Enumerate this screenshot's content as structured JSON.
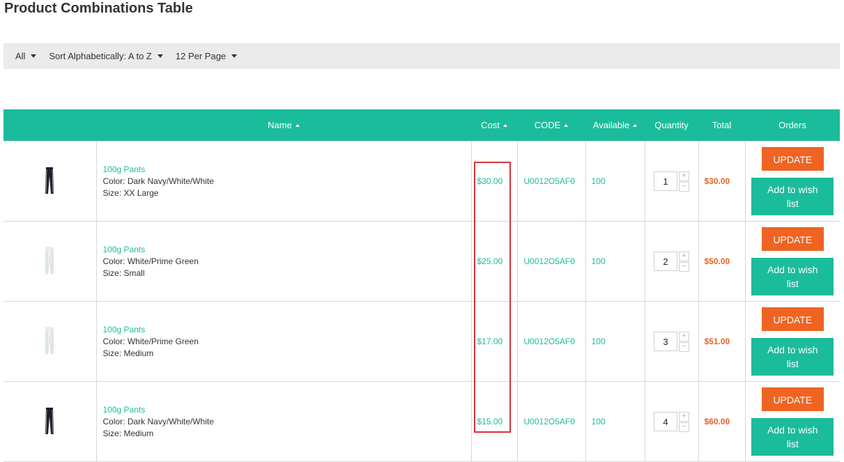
{
  "page": {
    "title": "Product Combinations Table"
  },
  "toolbar": {
    "filter": "All",
    "sort": "Sort Alphabetically: A to Z",
    "per_page": "12 Per Page"
  },
  "table": {
    "headers": {
      "name": "Name",
      "cost": "Cost",
      "code": "CODE",
      "available": "Available",
      "quantity": "Quantity",
      "total": "Total",
      "orders": "Orders"
    },
    "rows": [
      {
        "product": "100g Pants",
        "color": "Color: Dark Navy/White/White",
        "size": "Size: XX Large",
        "cost": "$30.00",
        "code": "U0012O5AF0",
        "available": "100",
        "quantity": "1",
        "total": "$30.00",
        "image": "pants-dark-icon"
      },
      {
        "product": "100g Pants",
        "color": "Color: White/Prime Green",
        "size": "Size: Small",
        "cost": "$25.00",
        "code": "U0012O5AF0",
        "available": "100",
        "quantity": "2",
        "total": "$50.00",
        "image": "pants-white-icon"
      },
      {
        "product": "100g Pants",
        "color": "Color: White/Prime Green",
        "size": "Size: Medium",
        "cost": "$17.00",
        "code": "U0012O5AF0",
        "available": "100",
        "quantity": "3",
        "total": "$51.00",
        "image": "pants-white-icon"
      },
      {
        "product": "100g Pants",
        "color": "Color: Dark Navy/White/White",
        "size": "Size: Medium",
        "cost": "$15.00",
        "code": "U0012O5AF0",
        "available": "100",
        "quantity": "4",
        "total": "$60.00",
        "image": "pants-dark-icon"
      }
    ],
    "buttons": {
      "update": "UPDATE",
      "wish": "Add to wish list",
      "plus": "+",
      "minus": "−"
    }
  },
  "colors": {
    "accent": "#1bbc9b",
    "orange": "#ef6422",
    "highlight": "#d5333b",
    "toolbar_bg": "#ebebeb"
  }
}
